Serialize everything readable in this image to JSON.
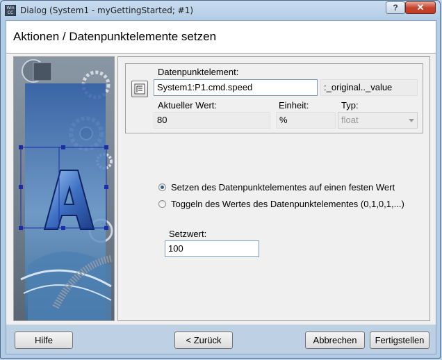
{
  "window": {
    "title": "Dialog (System1 - myGettingStarted; #1)",
    "app_icon_text": "WinCC OA",
    "help_button": "?",
    "close_button": "✕"
  },
  "header": {
    "title": "Aktionen / Datenpunktelemente setzen"
  },
  "datapoint": {
    "label": "Datenpunktelement:",
    "value": "System1:P1.cmd.speed",
    "config": ":_original.._value",
    "current_label": "Aktueller Wert:",
    "current_value": "80",
    "unit_label": "Einheit:",
    "unit_value": "%",
    "type_label": "Typ:",
    "type_value": "float"
  },
  "options": {
    "fixed_value": "Setzen des Datenpunktelementes auf einen festen Wert",
    "toggle": "Toggeln des Wertes des Datenpunktelementes (0,1,0,1,...)",
    "selected": "fixed_value"
  },
  "setvalue": {
    "label": "Setzwert:",
    "value": "100"
  },
  "footer": {
    "help": "Hilfe",
    "back": "< Zurück",
    "cancel": "Abbrechen",
    "finish": "Fertigstellen"
  },
  "colors": {
    "accent": "#2c628b",
    "selection_frame": "#1a2ea8"
  }
}
